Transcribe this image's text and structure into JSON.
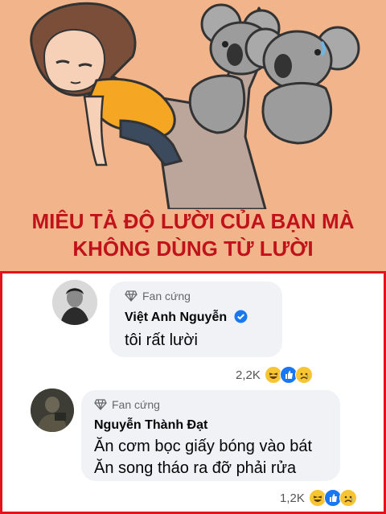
{
  "headline": {
    "line1": "MIÊU TẢ ĐỘ LƯỜI CỦA BẠN MÀ",
    "line2": "KHÔNG DÙNG TỪ LƯỜI"
  },
  "comments": [
    {
      "badge": "Fan cứng",
      "name": "Việt Anh Nguyễn",
      "verified": true,
      "lines": [
        "tôi rất lười"
      ],
      "reactions": "2,2K",
      "reaction_icons": [
        "haha-icon",
        "like-icon",
        "sad-icon"
      ]
    },
    {
      "badge": "Fan cứng",
      "name": "Nguyễn Thành Đạt",
      "verified": false,
      "lines": [
        "Ăn cơm bọc giấy bóng vào bát",
        "Ăn song tháo ra đỡ phải rửa"
      ],
      "reactions": "1,2K",
      "reaction_icons": [
        "haha-icon",
        "like-icon",
        "sad-icon"
      ]
    }
  ],
  "colors": {
    "background_top": "#F2B48A",
    "headline": "#C0121A",
    "frame": "#E3121B",
    "verified": "#1877F2"
  }
}
